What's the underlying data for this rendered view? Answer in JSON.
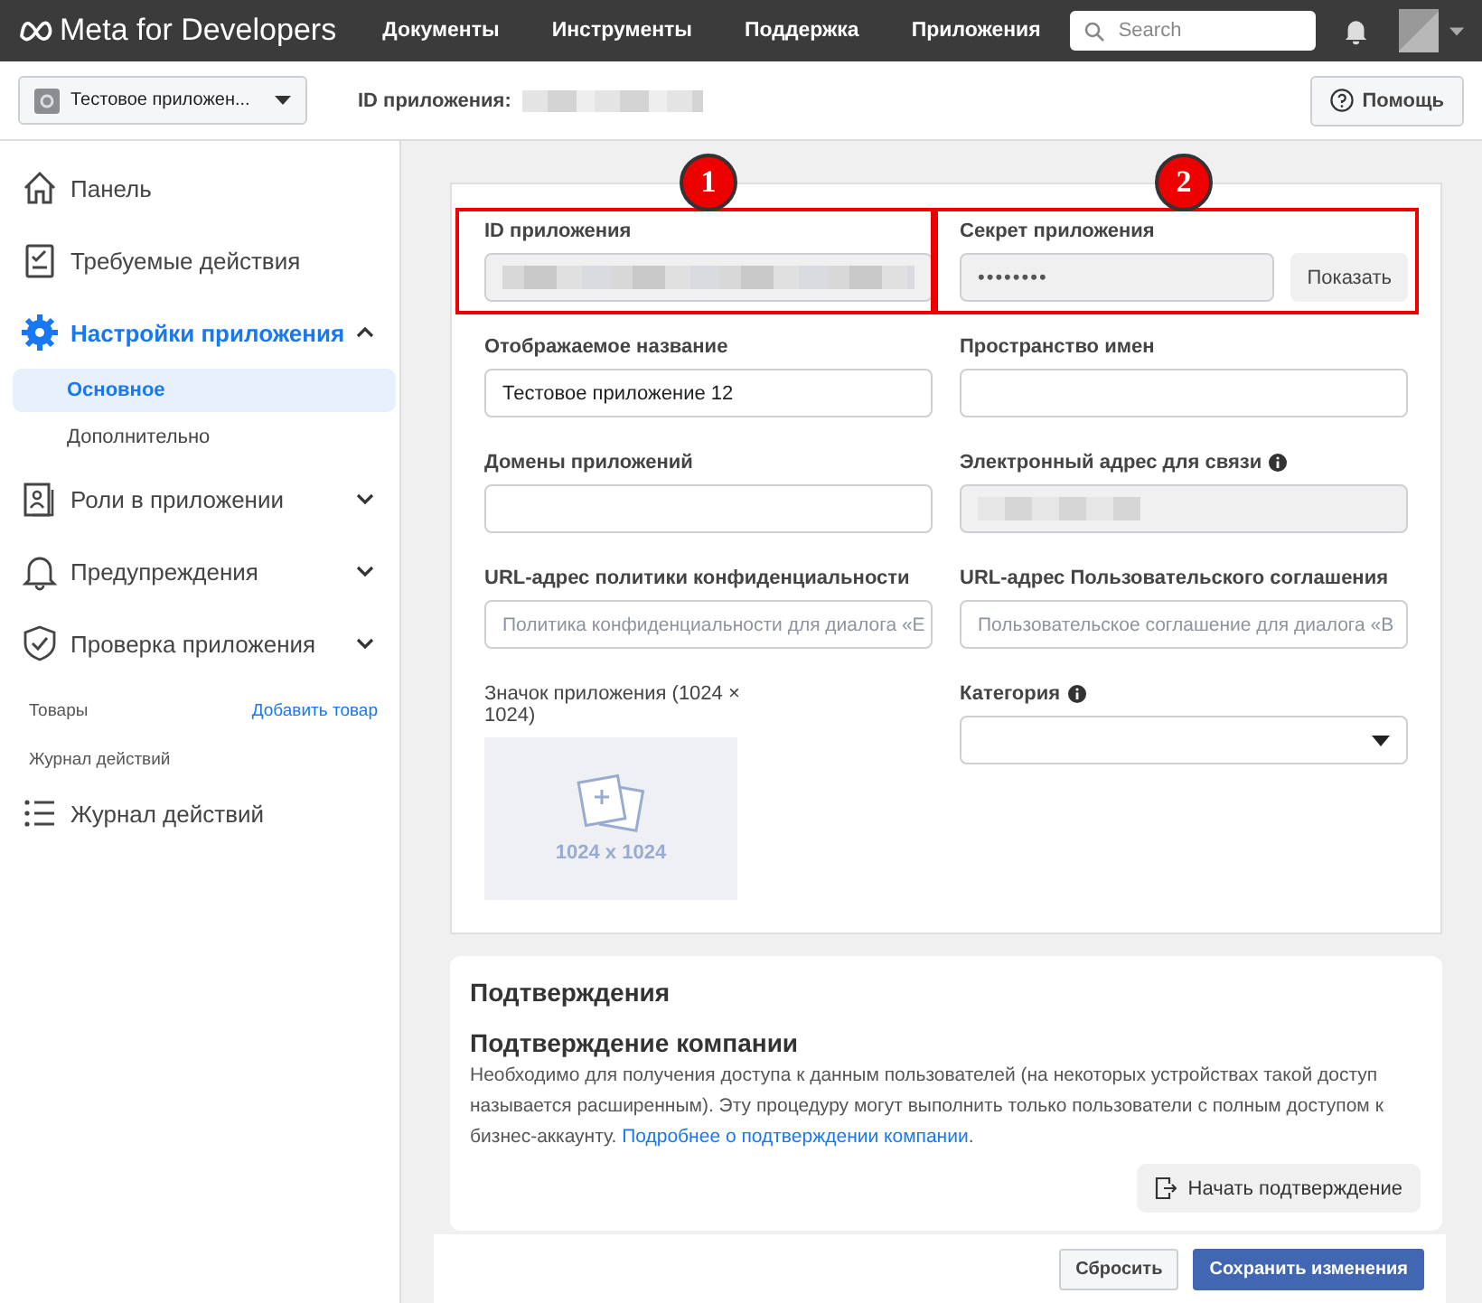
{
  "topbar": {
    "logo": "Meta for Developers",
    "nav": [
      "Документы",
      "Инструменты",
      "Поддержка",
      "Приложения"
    ],
    "search": {
      "placeholder": "Search"
    }
  },
  "appbar": {
    "app_selector": "Тестовое приложен...",
    "id_label": "ID приложения:",
    "help": "Помощь"
  },
  "sidebar": {
    "items": [
      {
        "kind": "nav",
        "label": "Панель",
        "active": false
      },
      {
        "kind": "nav",
        "label": "Требуемые действия",
        "active": false
      },
      {
        "kind": "nav",
        "label": "Настройки приложения",
        "active": true,
        "expanded": true
      },
      {
        "kind": "sub",
        "label": "Основное",
        "selected": true
      },
      {
        "kind": "sub",
        "label": "Дополнительно",
        "selected": false
      },
      {
        "kind": "nav",
        "label": "Роли в приложении",
        "active": false,
        "expanded": false
      },
      {
        "kind": "nav",
        "label": "Предупреждения",
        "active": false,
        "expanded": false
      },
      {
        "kind": "nav",
        "label": "Проверка приложения",
        "active": false,
        "expanded": false
      },
      {
        "kind": "section",
        "label": "Товары",
        "action": "Добавить товар"
      },
      {
        "kind": "section",
        "label": "Журнал действий"
      },
      {
        "kind": "nav",
        "label": "Журнал действий",
        "active": false
      }
    ]
  },
  "settings": {
    "fields": [
      {
        "kind": "blurred",
        "label": "ID приложения",
        "annotation": "1"
      },
      {
        "kind": "secret",
        "label": "Секрет приложения",
        "value": "••••••••",
        "button": "Показать",
        "annotation": "2"
      },
      {
        "kind": "text",
        "label": "Отображаемое название",
        "value": "Тестовое приложение 12"
      },
      {
        "kind": "text",
        "label": "Пространство имен"
      },
      {
        "kind": "text",
        "label": "Домены приложений"
      },
      {
        "kind": "blurred",
        "label": "Электронный адрес для связи",
        "info": true
      },
      {
        "kind": "text",
        "label": "URL-адрес политики конфиденциальности",
        "placeholder": "Политика конфиденциальности для диалога «Е"
      },
      {
        "kind": "text",
        "label": "URL-адрес Пользовательского соглашения",
        "placeholder": "Пользовательское соглашение для диалога «В"
      },
      {
        "kind": "image",
        "label": "Значок приложения (1024 × 1024)",
        "caption": "1024 x 1024"
      },
      {
        "kind": "select",
        "label": "Категория",
        "info": true
      }
    ]
  },
  "verification": {
    "title": "Подтверждения",
    "subtitle": "Подтверждение компании",
    "text": "Необходимо для получения доступа к данным пользователей (на некоторых устройствах такой доступ называется расширенным). Эту процедуру могут выполнить только пользователи с полным доступом к бизнес-аккаунту.",
    "link": "Подробнее о подтверждении компании",
    "link_end": ".",
    "button": "Начать подтверждение"
  },
  "footer": {
    "buttons": [
      {
        "label": "Сбросить",
        "primary": false
      },
      {
        "label": "Сохранить изменения",
        "primary": true
      }
    ]
  }
}
